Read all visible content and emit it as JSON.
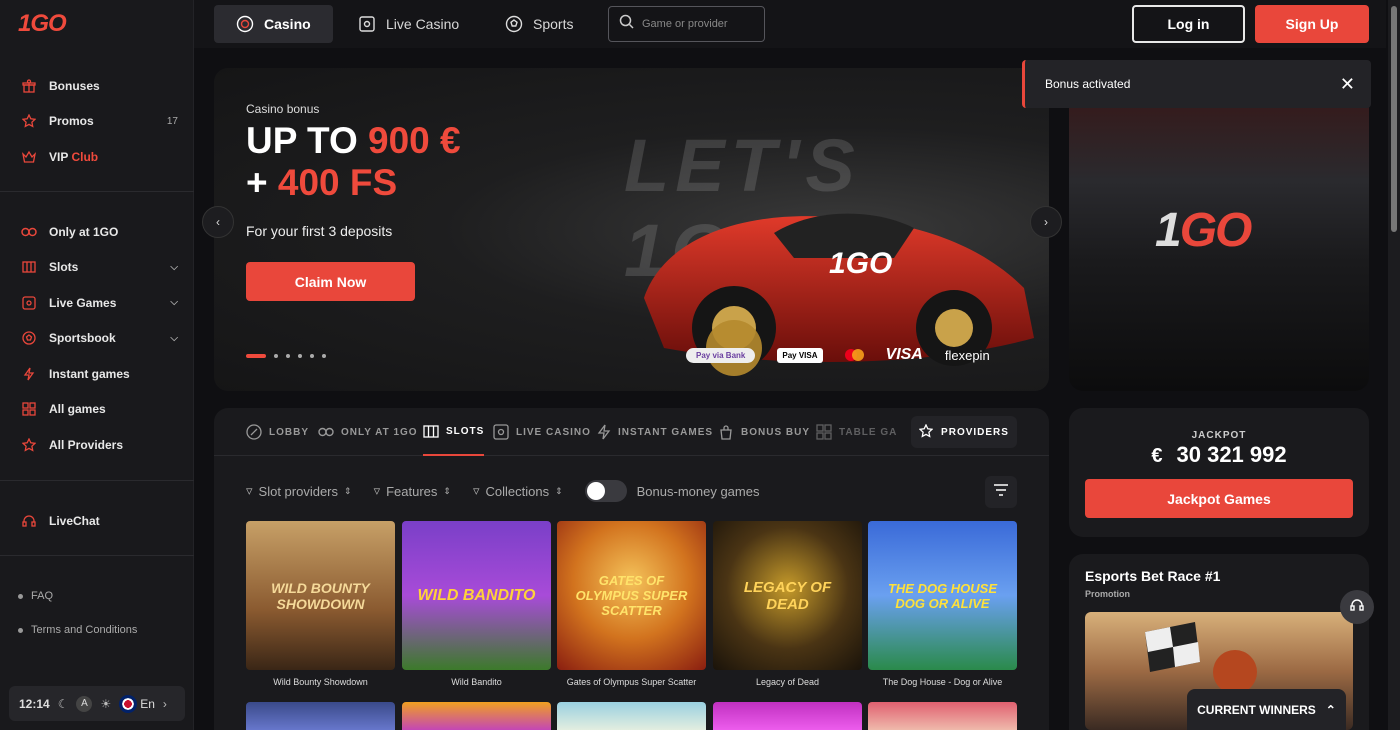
{
  "brand": {
    "logo": "1GO",
    "promo_logo_a": "1",
    "promo_logo_b": "GO",
    "bg_text": "LET'S 1GO"
  },
  "sidebar": {
    "top_items": [
      {
        "label": "Bonuses",
        "icon": "gift-icon"
      },
      {
        "label": "Promos",
        "icon": "star-icon",
        "count": "17"
      },
      {
        "label": "VIP",
        "label_accent": "Club",
        "icon": "crown-icon"
      }
    ],
    "items": [
      {
        "label": "Only at 1GO",
        "icon": "go-icon"
      },
      {
        "label": "Slots",
        "icon": "slots-icon"
      },
      {
        "label": "Live Games",
        "icon": "live-icon"
      },
      {
        "label": "Sportsbook",
        "icon": "ball-icon"
      },
      {
        "label": "Instant games",
        "icon": "lightning-icon"
      },
      {
        "label": "All games",
        "icon": "grid-icon"
      },
      {
        "label": "All Providers",
        "icon": "star-icon"
      }
    ],
    "livechat": "LiveChat",
    "links": [
      "FAQ",
      "Terms and Conditions"
    ],
    "bottom": {
      "time": "12:14",
      "lang": "En",
      "contrast": "A"
    }
  },
  "topnav": {
    "tabs": [
      "Casino",
      "Live Casino",
      "Sports"
    ],
    "search_placeholder": "Game or provider",
    "login": "Log in",
    "signup": "Sign Up"
  },
  "hero": {
    "kicker": "Casino bonus",
    "line1_a": "UP TO ",
    "line1_b": "900 €",
    "line2_a": "+ ",
    "line2_b": "400 FS",
    "sub": "For your first 3 deposits",
    "cta": "Claim Now",
    "payments": [
      "Pay via Bank",
      "Pay VISA",
      "VISA",
      "flexepin"
    ]
  },
  "toast": {
    "text": "Bonus activated"
  },
  "categories": [
    {
      "label": "LOBBY",
      "icon": "lobby-icon"
    },
    {
      "label": "ONLY AT 1GO",
      "icon": "go-icon"
    },
    {
      "label": "SLOTS",
      "icon": "slots-icon"
    },
    {
      "label": "LIVE CASINO",
      "icon": "live-icon"
    },
    {
      "label": "INSTANT GAMES",
      "icon": "lightning-icon"
    },
    {
      "label": "BONUS BUY",
      "icon": "bag-icon"
    },
    {
      "label": "TABLE GA",
      "icon": "table-icon"
    }
  ],
  "providers_btn": "PROVIDERS",
  "filters": {
    "slot_providers": "Slot providers",
    "features": "Features",
    "collections": "Collections",
    "bonus_money": "Bonus-money games"
  },
  "games": [
    {
      "name": "Wild Bounty Showdown",
      "art": "WILD BOUNTY SHOWDOWN"
    },
    {
      "name": "Wild Bandito",
      "art": "WILD BANDITO"
    },
    {
      "name": "Gates of Olympus Super Scatter",
      "art": "GATES OF OLYMPUS SUPER SCATTER"
    },
    {
      "name": "Legacy of Dead",
      "art": "LEGACY OF DEAD"
    },
    {
      "name": "The Dog House - Dog or Alive",
      "art": "THE DOG HOUSE DOG OR ALIVE"
    }
  ],
  "jackpot": {
    "label": "JACKPOT",
    "currency": "€",
    "amount": "30 321 992",
    "button": "Jackpot Games"
  },
  "esports": {
    "title": "Esports Bet Race #1",
    "subtitle": "Promotion"
  },
  "winners": "CURRENT WINNERS",
  "colors": {
    "accent": "#e9473b",
    "bg": "#0f0f12",
    "panel": "#1a1a1d"
  }
}
